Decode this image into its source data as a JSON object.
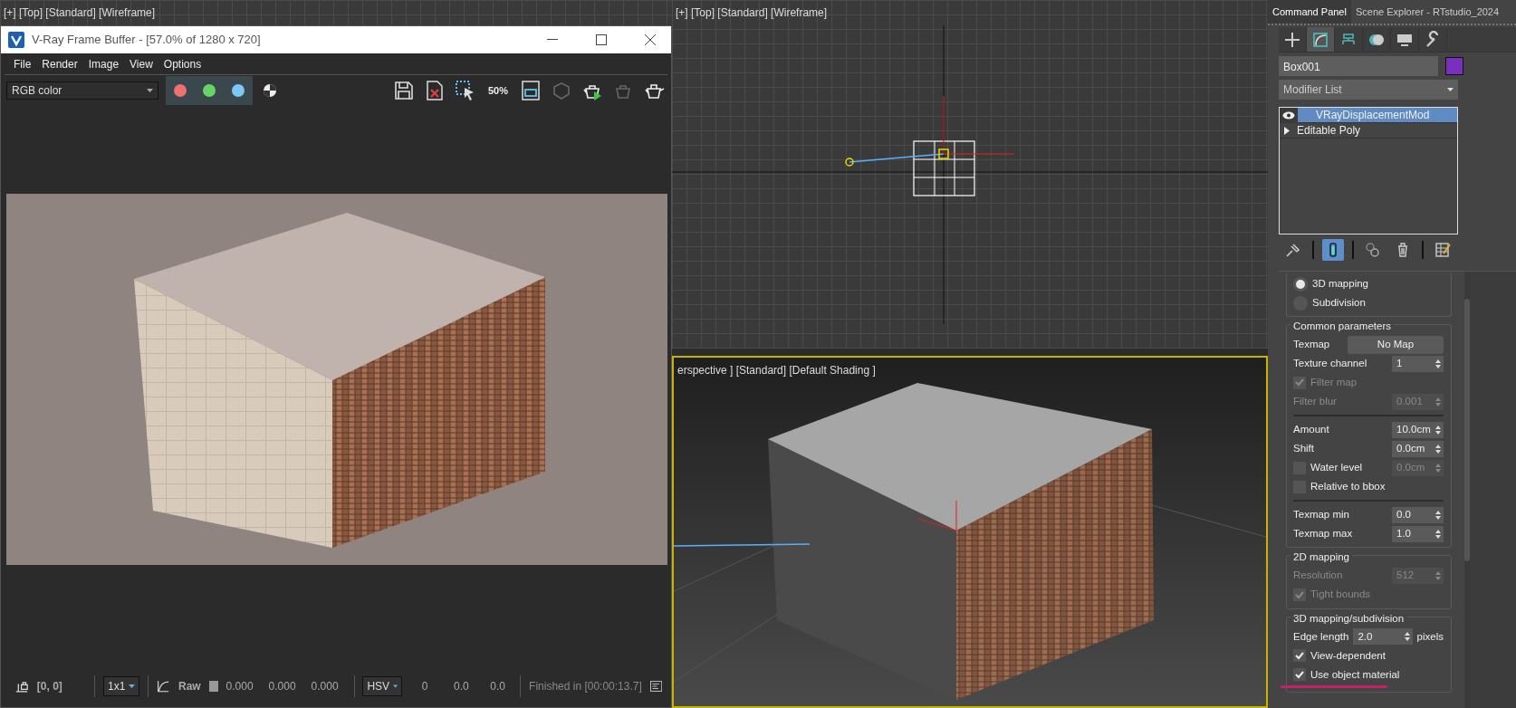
{
  "top_left_viewport": {
    "label": "[+] [Top] [Standard] [Wireframe]"
  },
  "frame_buffer": {
    "title": "V-Ray Frame Buffer - [57.0% of 1280 x 720]",
    "menu": [
      "File",
      "Render",
      "Image",
      "View",
      "Options"
    ],
    "channel": "RGB color",
    "channel_buttons": [
      {
        "color": "#f07070",
        "selected": true
      },
      {
        "color": "#66d466",
        "selected": true
      },
      {
        "color": "#7cc8f8",
        "selected": true
      }
    ],
    "zoom_label": "50%",
    "status": {
      "coords": "[0, 0]",
      "sampling": "1x1",
      "mode": "Raw",
      "rgb": [
        "0.000",
        "0.000",
        "0.000"
      ],
      "color_space": "HSV",
      "hsv": [
        "0",
        "0.0",
        "0.0"
      ],
      "message": "Finished in [00:00:13.7]"
    }
  },
  "top_viewport": {
    "label": "[+] [Top] [Standard] [Wireframe]"
  },
  "perspective_viewport": {
    "label": "erspective ] [Standard] [Default Shading ]",
    "active": true
  },
  "command_panel": {
    "tabs": [
      {
        "label": "Command Panel",
        "selected": true
      },
      {
        "label": "Scene Explorer - RTstudio_2024",
        "selected": false
      }
    ],
    "panel_tabs": [
      {
        "kind": "create",
        "selected": false
      },
      {
        "kind": "modify",
        "selected": true
      },
      {
        "kind": "hierarchy",
        "selected": false
      },
      {
        "kind": "motion",
        "selected": false
      },
      {
        "kind": "display",
        "selected": false
      },
      {
        "kind": "utilities",
        "selected": false
      }
    ],
    "object": {
      "name": "Box001",
      "color": "#7b2fbe"
    },
    "modifier_list": "Modifier List",
    "stack": [
      {
        "kind": "modifier",
        "label": "VRayDisplacementMod",
        "selected": true
      },
      {
        "kind": "object",
        "label": "Editable Poly",
        "selected": false
      }
    ],
    "stack_tools": [
      {
        "kind": "pin",
        "selected": false
      },
      {
        "kind": "end_result",
        "selected": true
      },
      {
        "kind": "unique",
        "selected": false
      },
      {
        "kind": "remove",
        "selected": false
      },
      {
        "kind": "configure",
        "selected": false
      }
    ],
    "groups": [
      {
        "rows": [
          {
            "kind": "radio",
            "label": "3D mapping",
            "selected": true
          },
          {
            "kind": "radio",
            "label": "Subdivision",
            "selected": false
          }
        ]
      },
      {
        "title": "Common parameters",
        "rows": [
          {
            "kind": "button",
            "label": "Texmap",
            "value": "No Map"
          },
          {
            "kind": "spinner",
            "label": "Texture channel",
            "value": "1",
            "disabled": false
          },
          {
            "kind": "check",
            "label": "Filter map",
            "checked": true,
            "disabled": true
          },
          {
            "kind": "spinner",
            "label": "Filter blur",
            "value": "0.001",
            "disabled": true
          },
          {
            "kind": "divider"
          },
          {
            "kind": "spinner",
            "label": "Amount",
            "value": "10.0cm",
            "disabled": false
          },
          {
            "kind": "spinner",
            "label": "Shift",
            "value": "0.0cm",
            "disabled": false
          },
          {
            "kind": "check_spinner",
            "label": "Water level",
            "checked": false,
            "value": "0.0cm",
            "disabled": true
          },
          {
            "kind": "check",
            "label": "Relative to bbox",
            "checked": false,
            "disabled": false
          },
          {
            "kind": "divider"
          },
          {
            "kind": "spinner",
            "label": "Texmap min",
            "value": "0.0",
            "disabled": false
          },
          {
            "kind": "spinner",
            "label": "Texmap max",
            "value": "1.0",
            "disabled": false
          }
        ]
      },
      {
        "title": "2D mapping",
        "rows": [
          {
            "kind": "spinner",
            "label": "Resolution",
            "value": "512",
            "disabled": true
          },
          {
            "kind": "check",
            "label": "Tight bounds",
            "checked": true,
            "disabled": true
          }
        ]
      },
      {
        "title": "3D mapping/subdivision",
        "rows": [
          {
            "kind": "spinner",
            "label": "Edge length",
            "value": "2.0",
            "unit": "pixels",
            "disabled": false
          },
          {
            "kind": "check",
            "label": "View-dependent",
            "checked": true,
            "disabled": false
          },
          {
            "kind": "check",
            "label": "Use object material",
            "checked": true,
            "disabled": false
          }
        ]
      }
    ]
  }
}
